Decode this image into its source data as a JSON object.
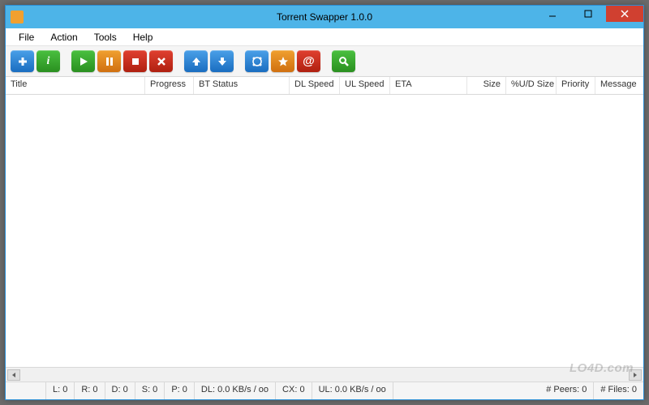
{
  "window": {
    "title": "Torrent Swapper 1.0.0"
  },
  "menu": {
    "file": "File",
    "action": "Action",
    "tools": "Tools",
    "help": "Help"
  },
  "toolbar_icons": {
    "add": "add-icon",
    "info": "info-icon",
    "play": "play-icon",
    "pause": "pause-icon",
    "stop": "stop-icon",
    "remove": "remove-icon",
    "up": "arrow-up-icon",
    "down": "arrow-down-icon",
    "dht": "dht-icon",
    "favorite": "star-icon",
    "at": "at-icon",
    "search": "search-icon"
  },
  "columns": {
    "title": "Title",
    "progress": "Progress",
    "bt_status": "BT Status",
    "dl_speed": "DL Speed",
    "ul_speed": "UL Speed",
    "eta": "ETA",
    "size": "Size",
    "pct_ud_size": "%U/D Size",
    "priority": "Priority",
    "message": "Message"
  },
  "status": {
    "l": "L: 0",
    "r": "R: 0",
    "d": "D: 0",
    "s": "S: 0",
    "p": "P: 0",
    "dl": "DL: 0.0 KB/s / oo",
    "cx": "CX: 0",
    "ul": "UL: 0.0 KB/s / oo",
    "peers": "# Peers: 0",
    "files": "# Files: 0"
  },
  "watermark": "LO4D.com"
}
